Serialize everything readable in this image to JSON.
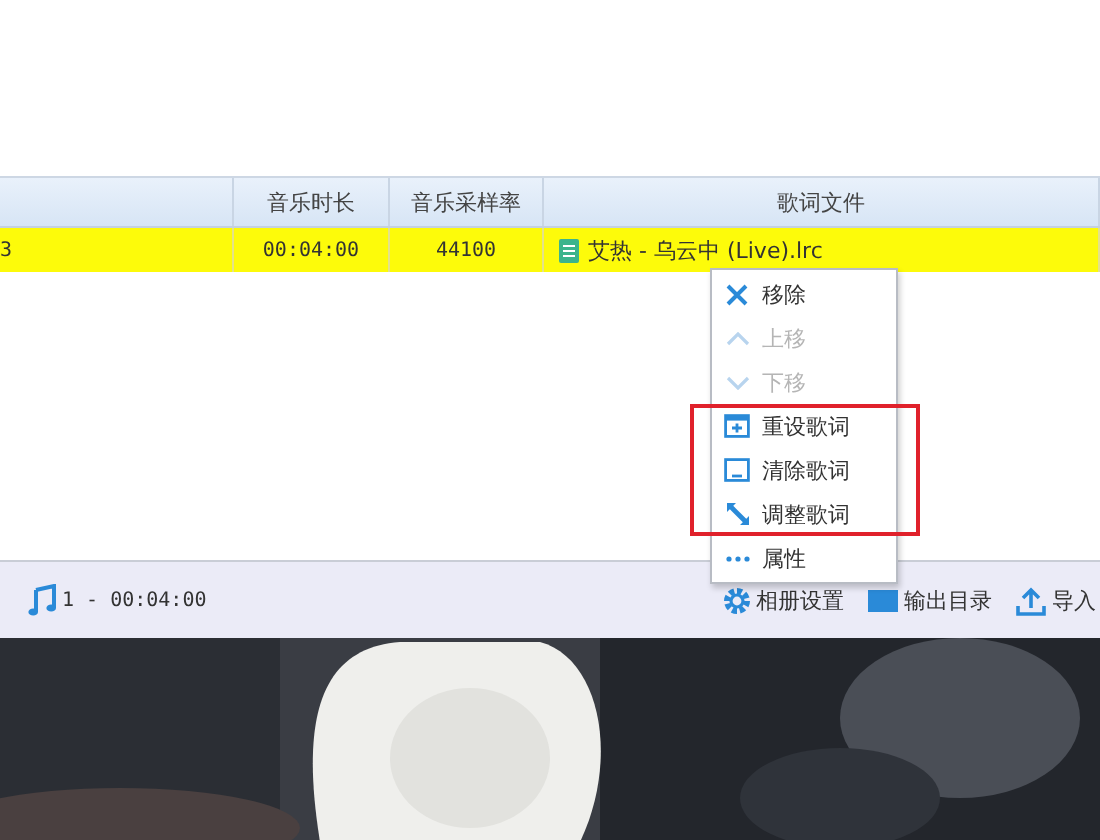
{
  "table": {
    "columns": [
      "",
      "音乐时长",
      "音乐采样率",
      "歌词文件"
    ],
    "rows": [
      {
        "selected": true,
        "cells": [
          "3",
          "00:04:00",
          "44100",
          "艾热 - 乌云中 (Live).lrc"
        ]
      }
    ]
  },
  "context_menu": {
    "items": [
      {
        "kind": "remove",
        "label": "移除",
        "disabled": false,
        "highlighted": false
      },
      {
        "kind": "up",
        "label": "上移",
        "disabled": true,
        "highlighted": false
      },
      {
        "kind": "down",
        "label": "下移",
        "disabled": true,
        "highlighted": false
      },
      {
        "kind": "reset",
        "label": "重设歌词",
        "disabled": false,
        "highlighted": true
      },
      {
        "kind": "clear",
        "label": "清除歌词",
        "disabled": false,
        "highlighted": true
      },
      {
        "kind": "adjust",
        "label": "调整歌词",
        "disabled": false,
        "highlighted": true
      },
      {
        "kind": "props",
        "label": "属性",
        "disabled": false,
        "highlighted": false
      }
    ]
  },
  "status_bar": {
    "summary": "1 - 00:04:00",
    "buttons": [
      {
        "kind": "settings",
        "label": "相册设置"
      },
      {
        "kind": "output",
        "label": "输出目录"
      },
      {
        "kind": "import",
        "label": "导入"
      }
    ]
  }
}
